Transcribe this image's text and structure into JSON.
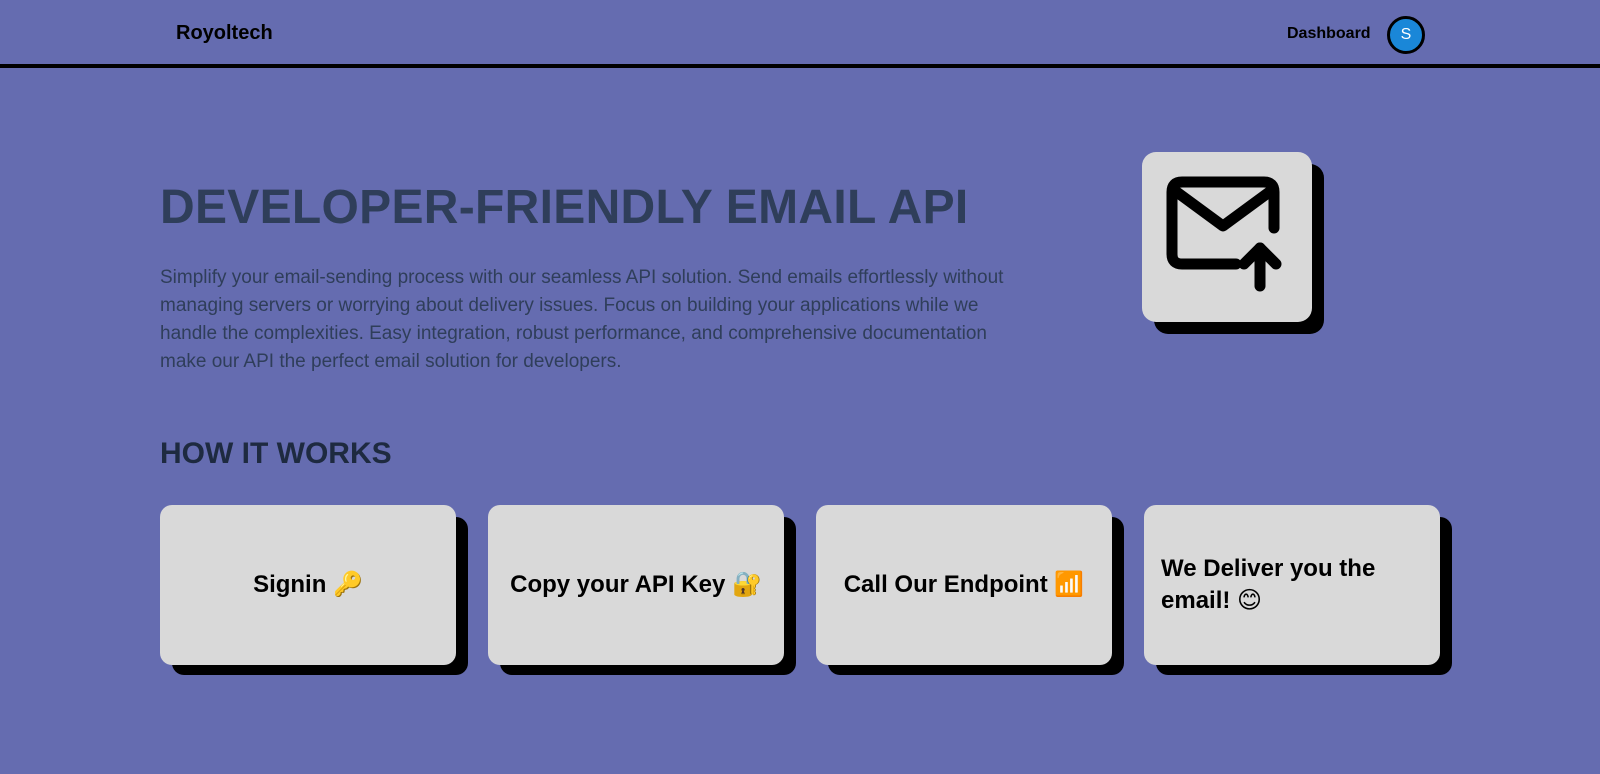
{
  "nav": {
    "brand": "Royoltech",
    "dashboard_label": "Dashboard",
    "avatar_initial": "S"
  },
  "hero": {
    "title": "DEVELOPER-FRIENDLY EMAIL API",
    "description": "Simplify your email-sending process with our seamless API solution. Send emails effortlessly without managing servers or worrying about delivery issues. Focus on building your applications while we handle the complexities. Easy integration, robust performance, and comprehensive documentation make our API the perfect email solution for developers.",
    "icon": "mail-upload-icon"
  },
  "how_it_works": {
    "title": "HOW IT WORKS",
    "steps": [
      {
        "label": "Signin 🔑"
      },
      {
        "label": "Copy your API Key 🔐"
      },
      {
        "label": "Call Our Endpoint 📶"
      },
      {
        "label": "We Deliver you the email! 😊"
      }
    ]
  },
  "colors": {
    "background": "#656cb0",
    "card": "#d9d9d9",
    "heading": "#2f3e5a",
    "avatar": "#1a87d8"
  }
}
